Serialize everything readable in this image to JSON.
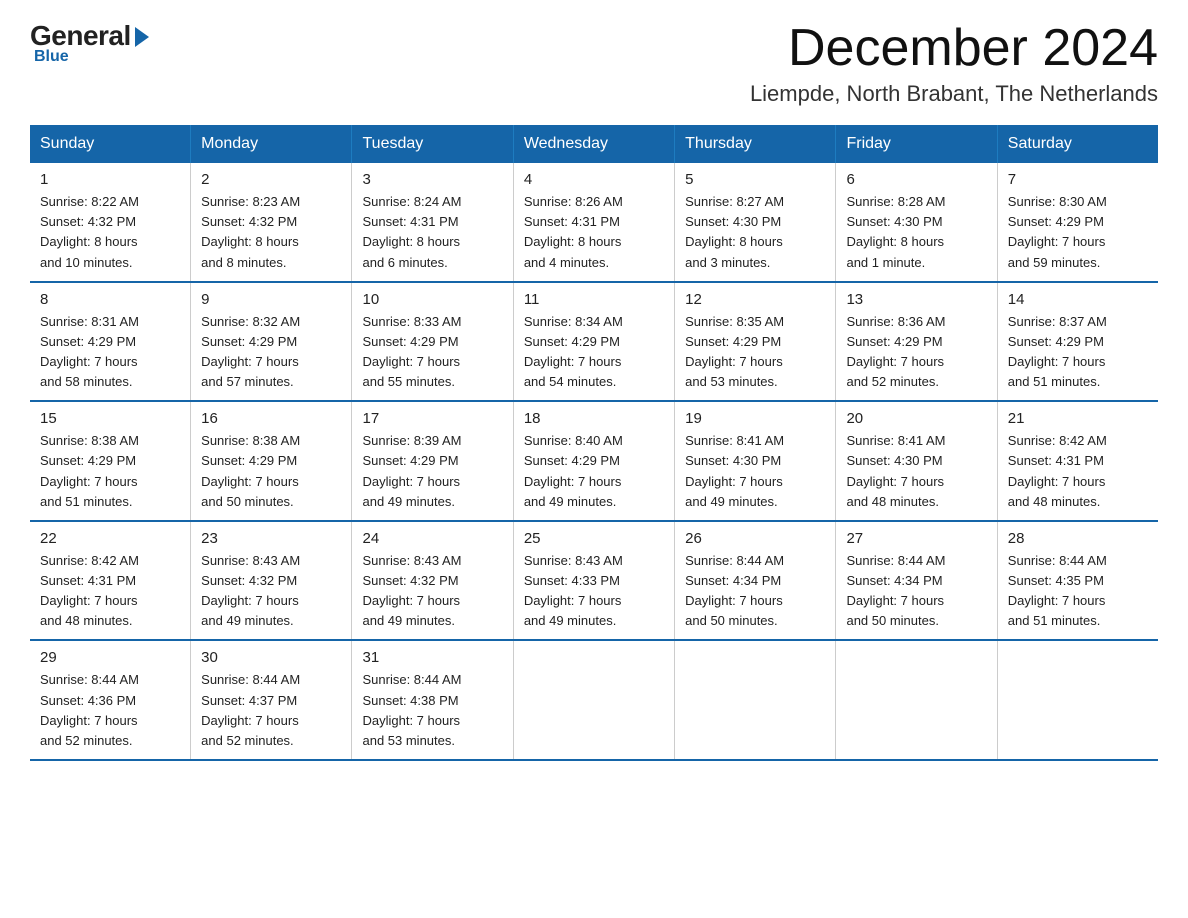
{
  "logo": {
    "general": "General",
    "blue": "Blue"
  },
  "title": "December 2024",
  "subtitle": "Liempde, North Brabant, The Netherlands",
  "weekdays": [
    "Sunday",
    "Monday",
    "Tuesday",
    "Wednesday",
    "Thursday",
    "Friday",
    "Saturday"
  ],
  "weeks": [
    [
      {
        "day": "1",
        "info": "Sunrise: 8:22 AM\nSunset: 4:32 PM\nDaylight: 8 hours\nand 10 minutes."
      },
      {
        "day": "2",
        "info": "Sunrise: 8:23 AM\nSunset: 4:32 PM\nDaylight: 8 hours\nand 8 minutes."
      },
      {
        "day": "3",
        "info": "Sunrise: 8:24 AM\nSunset: 4:31 PM\nDaylight: 8 hours\nand 6 minutes."
      },
      {
        "day": "4",
        "info": "Sunrise: 8:26 AM\nSunset: 4:31 PM\nDaylight: 8 hours\nand 4 minutes."
      },
      {
        "day": "5",
        "info": "Sunrise: 8:27 AM\nSunset: 4:30 PM\nDaylight: 8 hours\nand 3 minutes."
      },
      {
        "day": "6",
        "info": "Sunrise: 8:28 AM\nSunset: 4:30 PM\nDaylight: 8 hours\nand 1 minute."
      },
      {
        "day": "7",
        "info": "Sunrise: 8:30 AM\nSunset: 4:29 PM\nDaylight: 7 hours\nand 59 minutes."
      }
    ],
    [
      {
        "day": "8",
        "info": "Sunrise: 8:31 AM\nSunset: 4:29 PM\nDaylight: 7 hours\nand 58 minutes."
      },
      {
        "day": "9",
        "info": "Sunrise: 8:32 AM\nSunset: 4:29 PM\nDaylight: 7 hours\nand 57 minutes."
      },
      {
        "day": "10",
        "info": "Sunrise: 8:33 AM\nSunset: 4:29 PM\nDaylight: 7 hours\nand 55 minutes."
      },
      {
        "day": "11",
        "info": "Sunrise: 8:34 AM\nSunset: 4:29 PM\nDaylight: 7 hours\nand 54 minutes."
      },
      {
        "day": "12",
        "info": "Sunrise: 8:35 AM\nSunset: 4:29 PM\nDaylight: 7 hours\nand 53 minutes."
      },
      {
        "day": "13",
        "info": "Sunrise: 8:36 AM\nSunset: 4:29 PM\nDaylight: 7 hours\nand 52 minutes."
      },
      {
        "day": "14",
        "info": "Sunrise: 8:37 AM\nSunset: 4:29 PM\nDaylight: 7 hours\nand 51 minutes."
      }
    ],
    [
      {
        "day": "15",
        "info": "Sunrise: 8:38 AM\nSunset: 4:29 PM\nDaylight: 7 hours\nand 51 minutes."
      },
      {
        "day": "16",
        "info": "Sunrise: 8:38 AM\nSunset: 4:29 PM\nDaylight: 7 hours\nand 50 minutes."
      },
      {
        "day": "17",
        "info": "Sunrise: 8:39 AM\nSunset: 4:29 PM\nDaylight: 7 hours\nand 49 minutes."
      },
      {
        "day": "18",
        "info": "Sunrise: 8:40 AM\nSunset: 4:29 PM\nDaylight: 7 hours\nand 49 minutes."
      },
      {
        "day": "19",
        "info": "Sunrise: 8:41 AM\nSunset: 4:30 PM\nDaylight: 7 hours\nand 49 minutes."
      },
      {
        "day": "20",
        "info": "Sunrise: 8:41 AM\nSunset: 4:30 PM\nDaylight: 7 hours\nand 48 minutes."
      },
      {
        "day": "21",
        "info": "Sunrise: 8:42 AM\nSunset: 4:31 PM\nDaylight: 7 hours\nand 48 minutes."
      }
    ],
    [
      {
        "day": "22",
        "info": "Sunrise: 8:42 AM\nSunset: 4:31 PM\nDaylight: 7 hours\nand 48 minutes."
      },
      {
        "day": "23",
        "info": "Sunrise: 8:43 AM\nSunset: 4:32 PM\nDaylight: 7 hours\nand 49 minutes."
      },
      {
        "day": "24",
        "info": "Sunrise: 8:43 AM\nSunset: 4:32 PM\nDaylight: 7 hours\nand 49 minutes."
      },
      {
        "day": "25",
        "info": "Sunrise: 8:43 AM\nSunset: 4:33 PM\nDaylight: 7 hours\nand 49 minutes."
      },
      {
        "day": "26",
        "info": "Sunrise: 8:44 AM\nSunset: 4:34 PM\nDaylight: 7 hours\nand 50 minutes."
      },
      {
        "day": "27",
        "info": "Sunrise: 8:44 AM\nSunset: 4:34 PM\nDaylight: 7 hours\nand 50 minutes."
      },
      {
        "day": "28",
        "info": "Sunrise: 8:44 AM\nSunset: 4:35 PM\nDaylight: 7 hours\nand 51 minutes."
      }
    ],
    [
      {
        "day": "29",
        "info": "Sunrise: 8:44 AM\nSunset: 4:36 PM\nDaylight: 7 hours\nand 52 minutes."
      },
      {
        "day": "30",
        "info": "Sunrise: 8:44 AM\nSunset: 4:37 PM\nDaylight: 7 hours\nand 52 minutes."
      },
      {
        "day": "31",
        "info": "Sunrise: 8:44 AM\nSunset: 4:38 PM\nDaylight: 7 hours\nand 53 minutes."
      },
      null,
      null,
      null,
      null
    ]
  ]
}
